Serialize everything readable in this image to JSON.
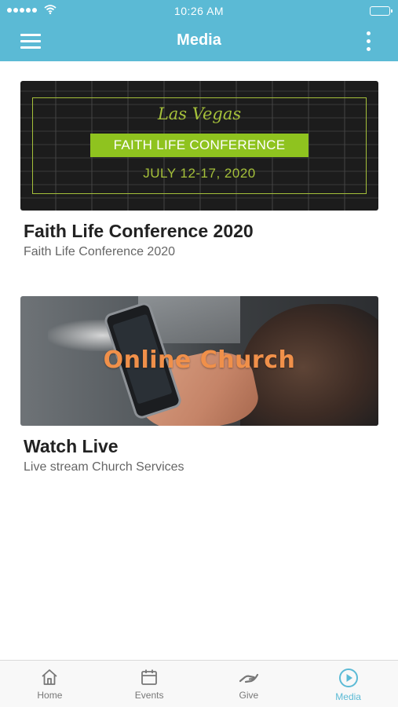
{
  "status_bar": {
    "time": "10:26 AM"
  },
  "nav": {
    "title": "Media"
  },
  "cards": [
    {
      "title": "Faith Life Conference 2020",
      "subtitle": "Faith Life Conference 2020",
      "banner": {
        "script": "Las Vegas",
        "bar": "FAITH LIFE CONFERENCE",
        "dates": "JULY 12-17, 2020"
      }
    },
    {
      "title": "Watch Live",
      "subtitle": "Live stream Church Services",
      "banner": {
        "headline": "Online Church"
      }
    }
  ],
  "tabs": [
    {
      "label": "Home",
      "icon": "home-icon",
      "active": false
    },
    {
      "label": "Events",
      "icon": "calendar-icon",
      "active": false
    },
    {
      "label": "Give",
      "icon": "give-icon",
      "active": false
    },
    {
      "label": "Media",
      "icon": "play-circle-icon",
      "active": true
    }
  ],
  "colors": {
    "header": "#5bbad5",
    "accent": "#5bbad5",
    "conference_green": "#8fc31f",
    "live_orange": "#f0904a"
  }
}
